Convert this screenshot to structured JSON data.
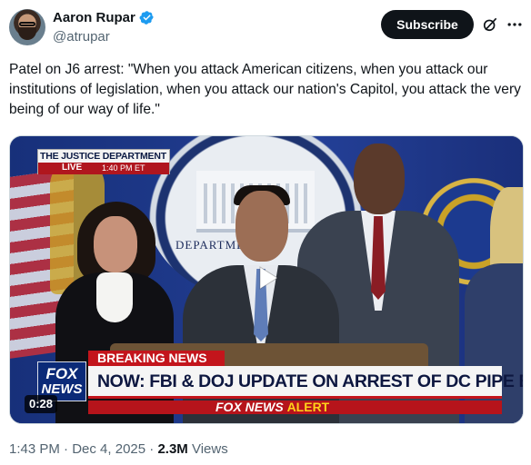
{
  "author": {
    "display_name": "Aaron Rupar",
    "handle": "@atrupar",
    "verified_color": "#1d9bf0"
  },
  "header": {
    "subscribe_label": "Subscribe",
    "grok_icon": "grok-icon",
    "more_icon": "more-icon"
  },
  "tweet": {
    "text": "Patel on J6 arrest: \"When you attack American citizens, when you attack our institutions of legislation, when you attack our nation's Capitol, you attack the very being of our way of life.\""
  },
  "video": {
    "duration": "0:28",
    "play_icon": "play-icon",
    "overlay": {
      "source": "THE JUSTICE DEPARTMENT",
      "live_label": "LIVE",
      "live_time": "1:40 PM ET",
      "seal_text": "DEPARTME",
      "breaking_label": "BREAKING NEWS",
      "headline": "NOW: FBI & DOJ UPDATE ON ARREST OF DC PIPE BOMBER",
      "alert_brand": "FOX NEWS",
      "alert_word": "ALERT",
      "logo_line1": "FOX",
      "logo_line2": "NEWS"
    }
  },
  "meta": {
    "time": "1:43 PM",
    "separator": "·",
    "date": "Dec 4, 2025",
    "views_count": "2.3M",
    "views_label": "Views"
  },
  "colors": {
    "text": "#0f1419",
    "secondary": "#536471",
    "breaking_red": "#c3151c"
  }
}
